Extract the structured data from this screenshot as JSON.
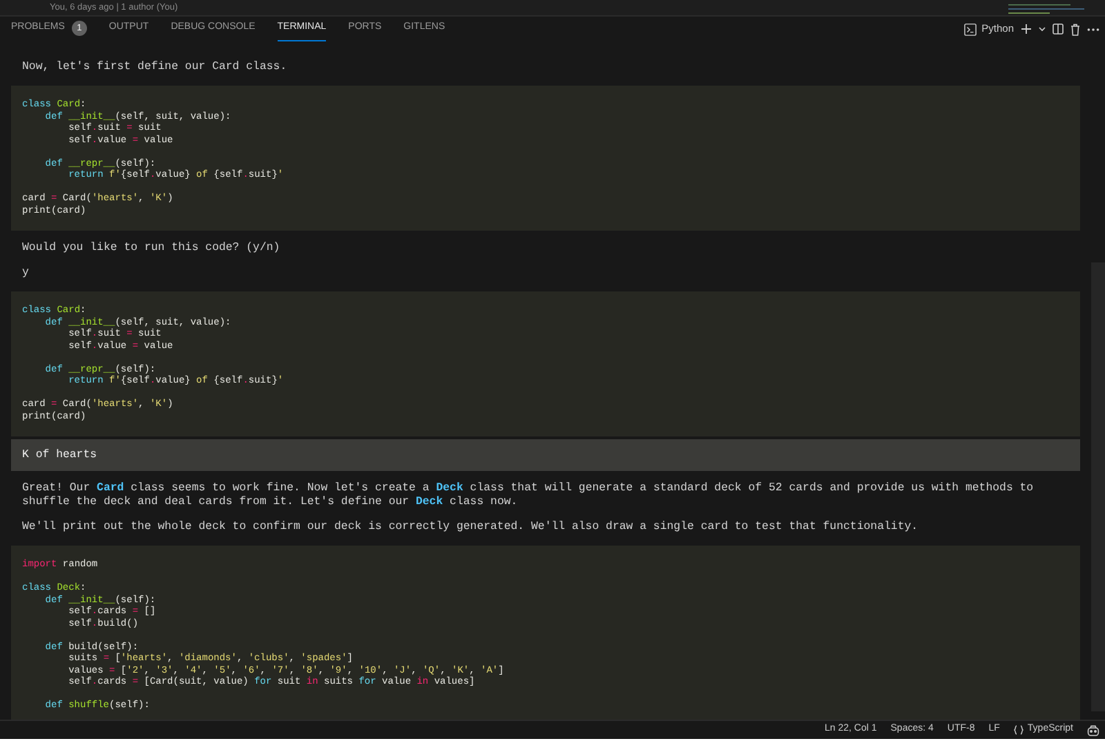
{
  "blame": "You, 6 days ago | 1 author (You)",
  "tabs": [
    {
      "label": "PROBLEMS",
      "badge": "1",
      "selected": false
    },
    {
      "label": "OUTPUT",
      "selected": false
    },
    {
      "label": "DEBUG CONSOLE",
      "selected": false
    },
    {
      "label": "TERMINAL",
      "selected": true
    },
    {
      "label": "PORTS",
      "selected": false
    },
    {
      "label": "GITLENS",
      "selected": false
    }
  ],
  "toolbar": {
    "shell": "Python"
  },
  "blocks": [
    {
      "kind": "text",
      "segments": [
        {
          "kind": "plain",
          "text": "Now, let's first define our Card class."
        }
      ]
    },
    {
      "kind": "code",
      "groups": [
        [
          [
            {
              "kind": "kw",
              "text": "class"
            },
            {
              "kind": "name",
              "text": " Card"
            },
            {
              "kind": "plain",
              "text": ":"
            }
          ],
          [
            {
              "kind": "kw",
              "text": "    def"
            },
            {
              "kind": "name",
              "text": " __init__"
            },
            {
              "kind": "plain",
              "text": "(self, suit, value):"
            }
          ],
          [
            {
              "kind": "plain",
              "text": "        self"
            },
            {
              "kind": "op",
              "text": "."
            },
            {
              "kind": "plain",
              "text": "suit "
            },
            {
              "kind": "op",
              "text": "="
            },
            {
              "kind": "plain",
              "text": " suit"
            }
          ],
          [
            {
              "kind": "plain",
              "text": "        self"
            },
            {
              "kind": "op",
              "text": "."
            },
            {
              "kind": "plain",
              "text": "value "
            },
            {
              "kind": "op",
              "text": "="
            },
            {
              "kind": "plain",
              "text": " value"
            }
          ]
        ],
        [
          [
            {
              "kind": "kw",
              "text": "    def"
            },
            {
              "kind": "name",
              "text": " __repr__"
            },
            {
              "kind": "plain",
              "text": "(self):"
            }
          ],
          [
            {
              "kind": "kw",
              "text": "        return"
            },
            {
              "kind": "str",
              "text": " f'"
            },
            {
              "kind": "plain",
              "text": "{self"
            },
            {
              "kind": "op",
              "text": "."
            },
            {
              "kind": "plain",
              "text": "value}"
            },
            {
              "kind": "str",
              "text": " of "
            },
            {
              "kind": "plain",
              "text": "{self"
            },
            {
              "kind": "op",
              "text": "."
            },
            {
              "kind": "plain",
              "text": "suit}"
            },
            {
              "kind": "str",
              "text": "'"
            }
          ]
        ],
        [
          [
            {
              "kind": "plain",
              "text": "card "
            },
            {
              "kind": "op",
              "text": "="
            },
            {
              "kind": "plain",
              "text": " Card("
            },
            {
              "kind": "str",
              "text": "'hearts'"
            },
            {
              "kind": "plain",
              "text": ", "
            },
            {
              "kind": "str",
              "text": "'K'"
            },
            {
              "kind": "plain",
              "text": ")"
            }
          ],
          [
            {
              "kind": "plain",
              "text": "print(card)"
            }
          ]
        ]
      ]
    },
    {
      "kind": "text",
      "segments": [
        {
          "kind": "plain",
          "text": "Would you like to run this code? (y/n)"
        }
      ]
    },
    {
      "kind": "text",
      "segments": [
        {
          "kind": "plain",
          "text": "y"
        }
      ]
    },
    {
      "kind": "code",
      "groups": [
        [
          [
            {
              "kind": "kw",
              "text": "class"
            },
            {
              "kind": "name",
              "text": " Card"
            },
            {
              "kind": "plain",
              "text": ":"
            }
          ],
          [
            {
              "kind": "kw",
              "text": "    def"
            },
            {
              "kind": "name",
              "text": " __init__"
            },
            {
              "kind": "plain",
              "text": "(self, suit, value):"
            }
          ],
          [
            {
              "kind": "plain",
              "text": "        self"
            },
            {
              "kind": "op",
              "text": "."
            },
            {
              "kind": "plain",
              "text": "suit "
            },
            {
              "kind": "op",
              "text": "="
            },
            {
              "kind": "plain",
              "text": " suit"
            }
          ],
          [
            {
              "kind": "plain",
              "text": "        self"
            },
            {
              "kind": "op",
              "text": "."
            },
            {
              "kind": "plain",
              "text": "value "
            },
            {
              "kind": "op",
              "text": "="
            },
            {
              "kind": "plain",
              "text": " value"
            }
          ]
        ],
        [
          [
            {
              "kind": "kw",
              "text": "    def"
            },
            {
              "kind": "name",
              "text": " __repr__"
            },
            {
              "kind": "plain",
              "text": "(self):"
            }
          ],
          [
            {
              "kind": "kw",
              "text": "        return"
            },
            {
              "kind": "str",
              "text": " f'"
            },
            {
              "kind": "plain",
              "text": "{self"
            },
            {
              "kind": "op",
              "text": "."
            },
            {
              "kind": "plain",
              "text": "value}"
            },
            {
              "kind": "str",
              "text": " of "
            },
            {
              "kind": "plain",
              "text": "{self"
            },
            {
              "kind": "op",
              "text": "."
            },
            {
              "kind": "plain",
              "text": "suit}"
            },
            {
              "kind": "str",
              "text": "'"
            }
          ]
        ],
        [
          [
            {
              "kind": "plain",
              "text": "card "
            },
            {
              "kind": "op",
              "text": "="
            },
            {
              "kind": "plain",
              "text": " Card("
            },
            {
              "kind": "str",
              "text": "'hearts'"
            },
            {
              "kind": "plain",
              "text": ", "
            },
            {
              "kind": "str",
              "text": "'K'"
            },
            {
              "kind": "plain",
              "text": ")"
            }
          ],
          [
            {
              "kind": "plain",
              "text": "print(card)"
            }
          ]
        ]
      ]
    },
    {
      "kind": "output",
      "segments": [
        {
          "kind": "plain",
          "text": "K of hearts"
        }
      ]
    },
    {
      "kind": "text",
      "segments": [
        {
          "kind": "plain",
          "text": "Great! Our "
        },
        {
          "kind": "code",
          "text": "Card"
        },
        {
          "kind": "plain",
          "text": " class seems to work fine. Now let's create a "
        },
        {
          "kind": "code",
          "text": "Deck"
        },
        {
          "kind": "plain",
          "text": " class that will generate a standard deck of 52 cards and provide us with methods to shuffle the deck and deal cards from it. Let's define our "
        },
        {
          "kind": "code",
          "text": "Deck"
        },
        {
          "kind": "plain",
          "text": " class now."
        }
      ]
    },
    {
      "kind": "text",
      "segments": [
        {
          "kind": "plain",
          "text": "We'll print out the whole deck to confirm our deck is correctly generated. We'll also draw a single card to test that functionality."
        }
      ]
    },
    {
      "kind": "code",
      "groups": [
        [
          [
            {
              "kind": "kw2",
              "text": "import"
            },
            {
              "kind": "plain",
              "text": " random"
            }
          ]
        ],
        [
          [
            {
              "kind": "kw",
              "text": "class"
            },
            {
              "kind": "name",
              "text": " Deck"
            },
            {
              "kind": "plain",
              "text": ":"
            }
          ],
          [
            {
              "kind": "kw",
              "text": "    def"
            },
            {
              "kind": "name",
              "text": " __init__"
            },
            {
              "kind": "plain",
              "text": "(self):"
            }
          ],
          [
            {
              "kind": "plain",
              "text": "        self"
            },
            {
              "kind": "op",
              "text": "."
            },
            {
              "kind": "plain",
              "text": "cards "
            },
            {
              "kind": "op",
              "text": "="
            },
            {
              "kind": "plain",
              "text": " []"
            }
          ],
          [
            {
              "kind": "plain",
              "text": "        self"
            },
            {
              "kind": "op",
              "text": "."
            },
            {
              "kind": "plain",
              "text": "build()"
            }
          ]
        ],
        [
          [
            {
              "kind": "kw",
              "text": "    def"
            },
            {
              "kind": "plain",
              "text": " build(self):"
            }
          ],
          [
            {
              "kind": "plain",
              "text": "        suits "
            },
            {
              "kind": "op",
              "text": "="
            },
            {
              "kind": "plain",
              "text": " ["
            },
            {
              "kind": "str",
              "text": "'hearts'"
            },
            {
              "kind": "plain",
              "text": ", "
            },
            {
              "kind": "str",
              "text": "'diamonds'"
            },
            {
              "kind": "plain",
              "text": ", "
            },
            {
              "kind": "str",
              "text": "'clubs'"
            },
            {
              "kind": "plain",
              "text": ", "
            },
            {
              "kind": "str",
              "text": "'spades'"
            },
            {
              "kind": "plain",
              "text": "]"
            }
          ],
          [
            {
              "kind": "plain",
              "text": "        values "
            },
            {
              "kind": "op",
              "text": "="
            },
            {
              "kind": "plain",
              "text": " ["
            },
            {
              "kind": "str",
              "text": "'2'"
            },
            {
              "kind": "plain",
              "text": ", "
            },
            {
              "kind": "str",
              "text": "'3'"
            },
            {
              "kind": "plain",
              "text": ", "
            },
            {
              "kind": "str",
              "text": "'4'"
            },
            {
              "kind": "plain",
              "text": ", "
            },
            {
              "kind": "str",
              "text": "'5'"
            },
            {
              "kind": "plain",
              "text": ", "
            },
            {
              "kind": "str",
              "text": "'6'"
            },
            {
              "kind": "plain",
              "text": ", "
            },
            {
              "kind": "str",
              "text": "'7'"
            },
            {
              "kind": "plain",
              "text": ", "
            },
            {
              "kind": "str",
              "text": "'8'"
            },
            {
              "kind": "plain",
              "text": ", "
            },
            {
              "kind": "str",
              "text": "'9'"
            },
            {
              "kind": "plain",
              "text": ", "
            },
            {
              "kind": "str",
              "text": "'10'"
            },
            {
              "kind": "plain",
              "text": ", "
            },
            {
              "kind": "str",
              "text": "'J'"
            },
            {
              "kind": "plain",
              "text": ", "
            },
            {
              "kind": "str",
              "text": "'Q'"
            },
            {
              "kind": "plain",
              "text": ", "
            },
            {
              "kind": "str",
              "text": "'K'"
            },
            {
              "kind": "plain",
              "text": ", "
            },
            {
              "kind": "str",
              "text": "'A'"
            },
            {
              "kind": "plain",
              "text": "]"
            }
          ],
          [
            {
              "kind": "plain",
              "text": "        self"
            },
            {
              "kind": "op",
              "text": "."
            },
            {
              "kind": "plain",
              "text": "cards "
            },
            {
              "kind": "op",
              "text": "="
            },
            {
              "kind": "plain",
              "text": " [Card(suit, value) "
            },
            {
              "kind": "kw",
              "text": "for"
            },
            {
              "kind": "plain",
              "text": " suit "
            },
            {
              "kind": "kw2",
              "text": "in"
            },
            {
              "kind": "plain",
              "text": " suits "
            },
            {
              "kind": "kw",
              "text": "for"
            },
            {
              "kind": "plain",
              "text": " value "
            },
            {
              "kind": "kw2",
              "text": "in"
            },
            {
              "kind": "plain",
              "text": " values]"
            }
          ]
        ],
        [
          [
            {
              "kind": "kw",
              "text": "    def"
            },
            {
              "kind": "name",
              "text": " shuffle"
            },
            {
              "kind": "plain",
              "text": "(self):"
            }
          ]
        ]
      ]
    }
  ],
  "status_bar": {
    "position": "Ln 22, Col 1",
    "indent": "Spaces: 4",
    "encoding": "UTF-8",
    "eol": "LF",
    "language": "TypeScript"
  }
}
